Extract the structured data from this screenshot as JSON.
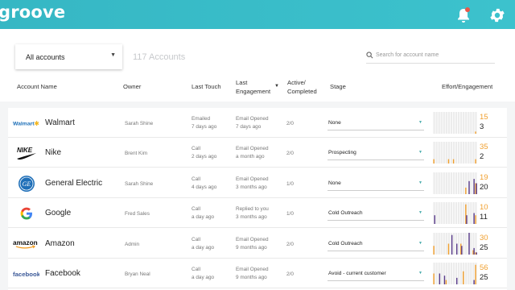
{
  "app": {
    "logo": "groove"
  },
  "icons": {
    "bell": "bell-icon",
    "gear": "gear-icon",
    "search": "search-icon",
    "caret": "caret-down-icon"
  },
  "colors": {
    "brand": "#3cbcc8",
    "effort": "#f0a030",
    "engagement": "#5a3d8c",
    "badge": "#e8584a"
  },
  "filters": {
    "account_select": "All accounts",
    "count_label": "117 Accounts",
    "search_placeholder": "Search for account name"
  },
  "columns": {
    "account_name": "Account Name",
    "owner": "Owner",
    "last_touch": "Last Touch",
    "last_engagement": "Last\nEngagement",
    "active_completed": "Active/\nCompleted",
    "stage": "Stage",
    "effort_engagement": "Effort/Engagement"
  },
  "rows": [
    {
      "logo": "Walmart",
      "name": "Walmart",
      "owner": "Sarah Shine",
      "touch_type": "Emailed",
      "touch_time": "7 days ago",
      "eng_type": "Email Opened",
      "eng_time": "7 days ago",
      "active": "2/0",
      "stage": "None",
      "effort": "15",
      "engagement": "3",
      "effort_bars": [
        0,
        0,
        0,
        0,
        0,
        0,
        0,
        0,
        0,
        0,
        0,
        0,
        0,
        0,
        0,
        0,
        0,
        0.1
      ],
      "eng_bars": [
        0,
        0,
        0,
        0,
        0,
        0,
        0,
        0,
        0,
        0,
        0,
        0,
        0,
        0,
        0,
        0,
        0,
        0
      ]
    },
    {
      "logo": "NIKE",
      "name": "Nike",
      "owner": "Brent Kim",
      "touch_type": "Call",
      "touch_time": "2 days ago",
      "eng_type": "Email Opened",
      "eng_time": "a month ago",
      "active": "2/0",
      "stage": "Prospecting",
      "effort": "35",
      "engagement": "2",
      "effort_bars": [
        0.2,
        0,
        0,
        0,
        0,
        0,
        0.2,
        0,
        0.2,
        0,
        0,
        0,
        0,
        0,
        0,
        0,
        0,
        0.2
      ],
      "eng_bars": [
        0,
        0,
        0,
        0,
        0,
        0,
        0,
        0,
        0,
        0,
        0,
        0,
        0,
        0,
        0,
        0,
        0,
        0
      ]
    },
    {
      "logo": "GE",
      "name": "General Electric",
      "owner": "Sarah Shine",
      "touch_type": "Call",
      "touch_time": "4 days ago",
      "eng_type": "Email Opened",
      "eng_time": "3 months ago",
      "active": "1/0",
      "stage": "None",
      "effort": "19",
      "engagement": "20",
      "effort_bars": [
        0,
        0,
        0,
        0,
        0,
        0,
        0,
        0,
        0,
        0,
        0,
        0,
        0,
        0.3,
        0,
        0,
        0,
        0.5
      ],
      "eng_bars": [
        0,
        0,
        0,
        0,
        0,
        0,
        0,
        0,
        0,
        0,
        0,
        0,
        0,
        0,
        0.6,
        0,
        0.7,
        0.5
      ]
    },
    {
      "logo": "G",
      "name": "Google",
      "owner": "Fred Sales",
      "touch_type": "Call",
      "touch_time": "a day ago",
      "eng_type": "Replied to you",
      "eng_time": "3 months ago",
      "active": "1/0",
      "stage": "Cold Outreach",
      "effort": "10",
      "engagement": "11",
      "effort_bars": [
        0,
        0,
        0,
        0,
        0,
        0,
        0,
        0,
        0,
        0,
        0,
        0,
        0,
        0.9,
        0,
        0,
        0,
        0.4
      ],
      "eng_bars": [
        0.4,
        0,
        0,
        0,
        0,
        0,
        0,
        0,
        0,
        0,
        0,
        0,
        0,
        0.4,
        0,
        0,
        0.5,
        0
      ]
    },
    {
      "logo": "amazon",
      "name": "Amazon",
      "owner": "Admin",
      "touch_type": "Call",
      "touch_time": "a day ago",
      "eng_type": "Email Opened",
      "eng_time": "9 months ago",
      "active": "2/0",
      "stage": "Cold Outreach",
      "effort": "30",
      "engagement": "25",
      "effort_bars": [
        0.4,
        0,
        0,
        0,
        0,
        0,
        0.5,
        0,
        0,
        0,
        0,
        0.5,
        0,
        0,
        0,
        0,
        0.2,
        0.1
      ],
      "eng_bars": [
        0,
        0,
        0,
        0,
        0,
        0,
        0,
        0.9,
        0,
        0.5,
        0,
        0.4,
        0,
        0,
        1.0,
        0,
        0.3,
        0.1
      ]
    },
    {
      "logo": "facebook",
      "name": "Facebook",
      "owner": "Bryan Neal",
      "touch_type": "Call",
      "touch_time": "a day ago",
      "eng_type": "Email Opened",
      "eng_time": "9 months ago",
      "active": "2/0",
      "stage": "Avoid - current customer",
      "effort": "56",
      "engagement": "25",
      "effort_bars": [
        0.5,
        0,
        0,
        0,
        0,
        0.2,
        0,
        0,
        0,
        0,
        0,
        0,
        0.6,
        0,
        0,
        0,
        0,
        0.9
      ],
      "eng_bars": [
        0,
        0,
        0.5,
        0,
        0.4,
        0,
        0,
        0,
        0,
        0.3,
        0,
        0,
        0,
        0,
        0,
        0,
        0.2,
        0
      ]
    }
  ]
}
